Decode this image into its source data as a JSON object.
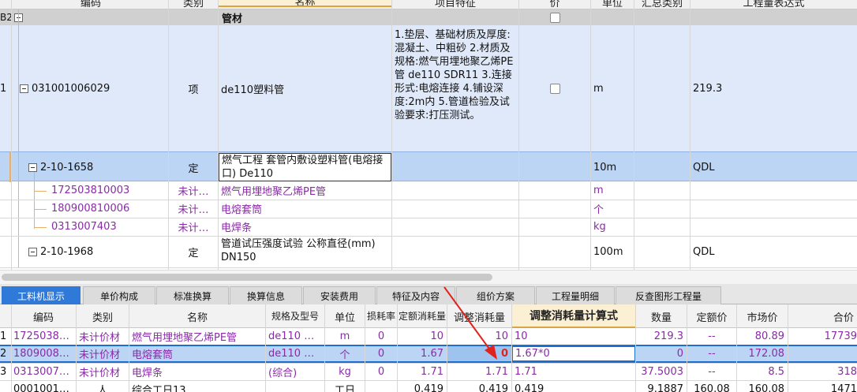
{
  "top_grid": {
    "header": {
      "code": "编码",
      "category": "类别",
      "name": "名称",
      "feature": "项目特征",
      "price_flag": "价",
      "unit": "单位",
      "summary_cat": "汇总类别",
      "qty_expr": "工程量表达式"
    },
    "group_row": {
      "index": "B2",
      "name": "管材"
    },
    "rows": [
      {
        "index": "1",
        "code": "031001006029",
        "category": "项",
        "name": "de110塑料管",
        "feature": "1.垫层、基础材质及厚度:混凝土、中粗砂 2.材质及规格:燃气用埋地聚乙烯PE管 de110 SDR11 3.连接形式:电熔连接 4.铺设深度:2m内 5.管道检验及试验要求:打压测试。",
        "unit": "m",
        "qty_expr": "219.3"
      },
      {
        "code": "2-10-1658",
        "category": "定",
        "name": "燃气工程 套管内敷设塑料管(电熔接口) De110",
        "unit": "10m",
        "qty_expr": "QDL"
      },
      {
        "code": "172503810003",
        "category": "未计…",
        "name": "燃气用埋地聚乙烯PE管",
        "unit": "m"
      },
      {
        "code": "180900810006",
        "category": "未计…",
        "name": "电熔套筒",
        "unit": "个"
      },
      {
        "code": "0313007403",
        "category": "未计…",
        "name": "电焊条",
        "unit": "kg"
      },
      {
        "code": "2-10-1968",
        "category": "定",
        "name": "管道试压强度试验 公称直径(mm) DN150",
        "unit": "100m",
        "qty_expr": "QDL"
      }
    ]
  },
  "tabs": [
    "工料机显示",
    "单价构成",
    "标准换算",
    "换算信息",
    "安装费用",
    "特征及内容",
    "组价方案",
    "工程量明细",
    "反查图形工程量"
  ],
  "bottom_grid": {
    "header": {
      "code": "编码",
      "category": "类别",
      "name": "名称",
      "spec": "规格及型号",
      "unit": "单位",
      "loss": "损耗率",
      "quota": "定额消耗量",
      "adjusted": "调整消耗量",
      "adj_expr": "调整消耗量计算式",
      "qty": "数量",
      "quota_price": "定额价",
      "market": "市场价",
      "total": "合价"
    },
    "rows": [
      {
        "index": "1",
        "code": "1725038…",
        "category": "未计价材",
        "name": "燃气用埋地聚乙烯PE管",
        "spec": "de110 …",
        "unit": "m",
        "loss": "0",
        "quota": "10",
        "adjusted": "10",
        "adj_expr": "10",
        "qty": "219.3",
        "quota_price": "--",
        "market": "80.89",
        "total": "17739"
      },
      {
        "index": "2",
        "code": "1809008…",
        "category": "未计价材",
        "name": "电熔套筒",
        "spec": "de110 …",
        "unit": "个",
        "loss": "0",
        "quota": "1.67",
        "adjusted": "0",
        "adj_expr": "1.67*0",
        "qty": "0",
        "quota_price": "--",
        "market": "172.08",
        "total": ""
      },
      {
        "index": "3",
        "code": "0313007…",
        "category": "未计价材",
        "name": "电焊条",
        "spec": "(综合)",
        "unit": "kg",
        "loss": "0",
        "quota": "1.71",
        "adjusted": "1.71",
        "adj_expr": "1.71",
        "qty": "37.5003",
        "quota_price": "--",
        "market": "8.5",
        "total": "318"
      },
      {
        "index": "",
        "code": "0001001…",
        "category": "人",
        "name": "综合工日13",
        "spec": "",
        "unit": "工日",
        "loss": "",
        "quota": "0.419",
        "adjusted": "0.419",
        "adj_expr": "0.419",
        "qty": "9.1887",
        "quota_price": "160.08",
        "market": "160.08",
        "total": "1471"
      }
    ]
  },
  "colors": {
    "tab_active": "#2f7ad8",
    "selection": "#1a6fd1",
    "purple_text": "#8a2aa8",
    "arrow": "#e0241b"
  }
}
